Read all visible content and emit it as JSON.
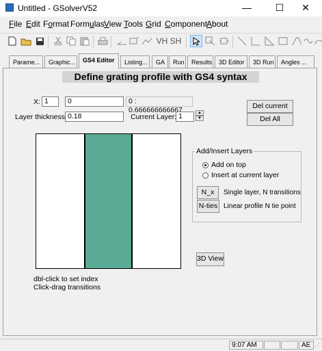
{
  "window": {
    "title": "Untitled - GSolverV52",
    "controls": {
      "minimize": "—",
      "maximize": "☐",
      "close": "✕"
    }
  },
  "menubar": {
    "items": [
      {
        "label": "File",
        "accel": "F",
        "rest": "ile"
      },
      {
        "label": "Edit",
        "accel": "E",
        "rest": "dit"
      },
      {
        "label": "Format",
        "pre": "F",
        "accel": "o",
        "rest": "rmat"
      },
      {
        "label": "Formulas",
        "pre": "Form",
        "accel": "u",
        "rest": "las"
      },
      {
        "label": "View",
        "accel": "V",
        "rest": "iew"
      },
      {
        "label": "Tools",
        "accel": "T",
        "rest": "ools"
      },
      {
        "label": "Grid",
        "accel": "G",
        "rest": "rid"
      },
      {
        "label": "Component",
        "accel": "C",
        "rest": "omponent"
      },
      {
        "label": "About",
        "accel": "A",
        "rest": "bout"
      }
    ]
  },
  "toolbar": {
    "icons": [
      "new-file-icon",
      "open-folder-icon",
      "save-icon",
      "cut-icon",
      "copy-icon",
      "paste-icon",
      "print-icon",
      "tool-a-icon",
      "tool-b-icon",
      "tool-c-icon",
      "tool-vh-icon",
      "tool-sh-icon",
      "pointer-icon",
      "tool-d-icon",
      "tool-e-icon",
      "line-icon",
      "line-seg-icon",
      "triangle-icon",
      "rectangle-icon",
      "curve-icon",
      "wave-icon",
      "arc-icon"
    ],
    "text_icons": {
      "vh": "VH",
      "sh": "SH"
    }
  },
  "tabs": [
    {
      "label": "Parame..."
    },
    {
      "label": "Graphic..."
    },
    {
      "label": "GS4 Editor",
      "active": true
    },
    {
      "label": "Listing..."
    },
    {
      "label": "GA"
    },
    {
      "label": "Run"
    },
    {
      "label": "Results"
    },
    {
      "label": "3D Editor"
    },
    {
      "label": "3D Run"
    },
    {
      "label": "Angles ..."
    }
  ],
  "editor": {
    "heading": "Define grating profile with GS4 syntax",
    "x_label": "X:",
    "x_value": "1",
    "expr_value": "0",
    "range_readout": "0 : 0.666666666667",
    "layer_thickness_label": "Layer thickness:",
    "layer_thickness_value": "0.18",
    "current_layer_label": "Current Layer:",
    "current_layer_value": "1",
    "del_current_label": "Del current",
    "del_all_label": "Del All",
    "group_title": "Add/Insert Layers",
    "radio_add_on_top": "Add on top",
    "radio_insert_current": "Insert at current layer",
    "radio_selected": "add_on_top",
    "nx_button": "N_x",
    "nx_desc": "Single layer, N transitions",
    "nties_button": "N-ties",
    "nties_desc": "Linear profile N tie point",
    "view3d_button": "3D View",
    "hint_line1": "dbl-click to set index",
    "hint_line2": "Click-drag transitions",
    "profile_color": "#5aab95"
  },
  "statusbar": {
    "time": "9:07 AM",
    "mode": "AE"
  }
}
